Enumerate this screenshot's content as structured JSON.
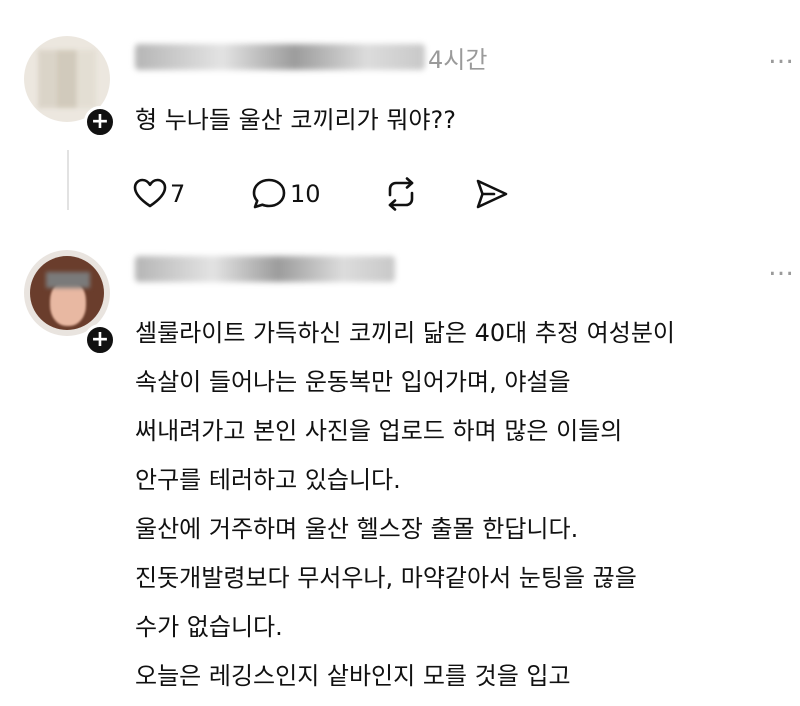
{
  "post1": {
    "time": "4시간",
    "text": "형 누나들 울산 코끼리가 뭐야??",
    "likes": "7",
    "replies": "10",
    "more": "…"
  },
  "post2": {
    "more": "…",
    "lines": [
      "셀룰라이트 가득하신 코끼리 닮은 40대 추정 여성분이",
      "속살이 들어나는 운동복만 입어가며, 야설을",
      "써내려가고 본인 사진을 업로드 하며 많은 이들의",
      "안구를 테러하고 있습니다.",
      "울산에 거주하며 울산 헬스장 출몰 한답니다.",
      "진돗개발령보다 무서우나, 마약같아서 눈팅을 끊을",
      "수가 없습니다.",
      "오늘은 레깅스인지 샅바인지 모를 것을 입고"
    ]
  },
  "colors": {
    "muted": "#9a9a9a",
    "text": "#111111",
    "background": "#ffffff"
  },
  "icons": [
    "heart-icon",
    "comment-icon",
    "repost-icon",
    "send-icon",
    "follow-plus-icon",
    "more-icon"
  ]
}
